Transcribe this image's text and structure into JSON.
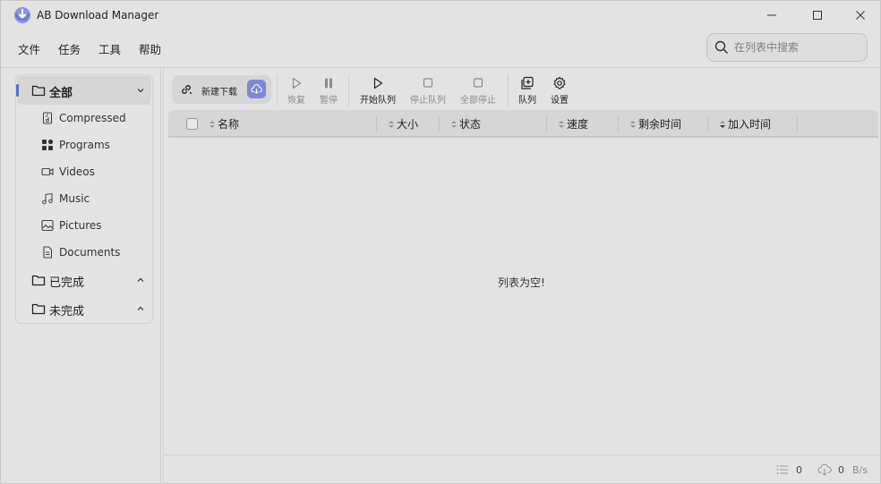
{
  "app": {
    "title": "AB Download Manager"
  },
  "window_controls": {
    "minimize": "minimize-icon",
    "maximize": "maximize-icon",
    "close": "close-icon"
  },
  "menu": [
    "文件",
    "任务",
    "工具",
    "帮助"
  ],
  "search": {
    "placeholder": "在列表中搜索",
    "value": ""
  },
  "sidebar": {
    "all": {
      "label": "全部",
      "icon": "folder-icon"
    },
    "categories": [
      {
        "label": "Compressed",
        "icon": "archive-icon"
      },
      {
        "label": "Programs",
        "icon": "apps-icon"
      },
      {
        "label": "Videos",
        "icon": "video-icon"
      },
      {
        "label": "Music",
        "icon": "music-icon"
      },
      {
        "label": "Pictures",
        "icon": "image-icon"
      },
      {
        "label": "Documents",
        "icon": "document-icon"
      }
    ],
    "completed": {
      "label": "已完成",
      "icon": "folder-icon"
    },
    "uncompleted": {
      "label": "未完成",
      "icon": "folder-icon"
    }
  },
  "toolbar": {
    "new_download": "新建下载",
    "resume": "恢复",
    "pause": "暂停",
    "start_queue": "开始队列",
    "stop_queue": "停止队列",
    "stop_all": "全部停止",
    "queues": "队列",
    "settings": "设置"
  },
  "table": {
    "columns": [
      "名称",
      "大小",
      "状态",
      "速度",
      "剩余时间",
      "加入时间"
    ],
    "empty_message": "列表为空!"
  },
  "statusbar": {
    "active_count": "0",
    "speed_value": "0",
    "speed_unit": "B/s"
  },
  "colors": {
    "accent": "#5a6bd1",
    "cloud_button": "#7d88d8",
    "background": "#e3e3e3"
  }
}
